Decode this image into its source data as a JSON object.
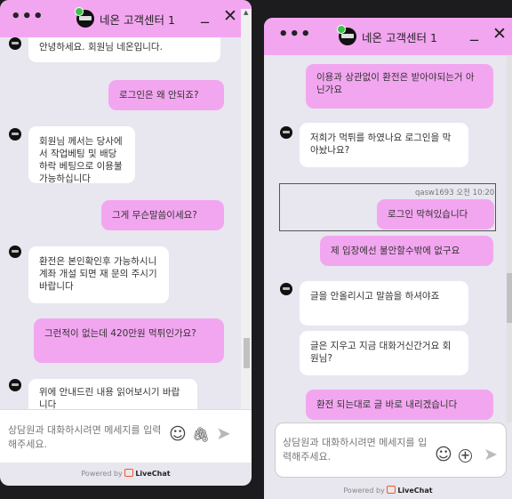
{
  "window_left": {
    "header": {
      "title": "네온 고객센터 1"
    },
    "messages": [
      {
        "text": "안녕하세요. 회원님 네온입니다."
      },
      {
        "text": "로그인은 왜 안되죠?"
      },
      {
        "text": "회원님 께서는 당사에서 작업베팅 및 배당하락 베팅으로 이용불가능하십니다"
      },
      {
        "text": "그게 무슨말씀이세요?"
      },
      {
        "text": "환전은 본인확인후 가능하시니 계좌 개설 되면 재 문의 주시기 바랍니다"
      },
      {
        "text": "그런적이 없는데 420만원 먹튀인가요?"
      },
      {
        "text": "위에 안내드린 내용 읽어보시기 바랍니다"
      }
    ],
    "composer": {
      "placeholder": "상담원과 대화하시려면 메세지를 입력해주세요."
    },
    "footer": {
      "powered_by": "Powered by",
      "brand": "LiveChat"
    }
  },
  "window_right": {
    "header": {
      "title": "네온 고객센터 1"
    },
    "messages": [
      {
        "text": "이용과 상관없이 환전은 받아야되는거 아닌가요"
      },
      {
        "text": "저희가 먹튀를 하였나요 로그인을 막아놨나요?"
      },
      {
        "text": "로그인 막혀있습니다",
        "meta": "qasw1693 오전 10:20"
      },
      {
        "text": "제 입장에선 불안할수밖에 없구요"
      },
      {
        "text": "글을 안올리시고 말씀을 하셔야죠"
      },
      {
        "text": "글은 지우고 지금 대화거신간거요 회원님?"
      },
      {
        "text": "환전 되는대로 글 바로 내리겠습니다"
      }
    ],
    "composer": {
      "placeholder": "상담원과 대화하시려면 메세지를 입력해주세요."
    },
    "footer": {
      "powered_by": "Powered by",
      "brand": "LiveChat"
    }
  },
  "icons": {
    "menu": "•••",
    "minimize": "_",
    "close": "✕",
    "emoji": "☺",
    "attach": "🖇",
    "send": "➤",
    "add": "+"
  },
  "colors": {
    "accent": "#f3a6f0",
    "background": "#e8e6ee",
    "bot_bubble": "#ffffff",
    "livechat": "#f15a24"
  }
}
